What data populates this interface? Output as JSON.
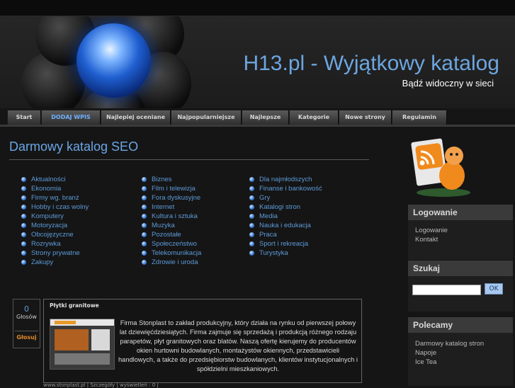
{
  "header": {
    "title": "H13.pl - Wyjątkowy katalog",
    "subtitle": "Bądź widoczny w sieci"
  },
  "nav": [
    {
      "label": "Start"
    },
    {
      "label": "DODAJ WPIS"
    },
    {
      "label": "Najlepiej oceniane"
    },
    {
      "label": "Najpopularniejsze"
    },
    {
      "label": "Najlepsze"
    },
    {
      "label": "Kategorie"
    },
    {
      "label": "Nowe strony"
    },
    {
      "label": "Regulamin"
    }
  ],
  "main": {
    "title": "Darmowy katalog SEO",
    "categories": {
      "col1": [
        "Aktualności",
        "Ekonomia",
        "Firmy wg. branż",
        "Hobby i czas wolny",
        "Komputery",
        "Motoryzacja",
        "Obcojęzyczne",
        "Rozrywka",
        "Strony prywatne",
        "Zakupy"
      ],
      "col2": [
        "Biznes",
        "Film i telewizja",
        "Fora dyskusyjne",
        "Internet",
        "Kultura i sztuka",
        "Muzyka",
        "Pozostałe",
        "Społeczeństwo",
        "Telekomunikacja",
        "Zdrowie i uroda"
      ],
      "col3": [
        "Dla najmłodszych",
        "Finanse i bankowość",
        "Gry",
        "Katalogi stron",
        "Media",
        "Nauka i edukacja",
        "Praca",
        "Sport i rekreacja",
        "Turystyka"
      ]
    }
  },
  "entry": {
    "votes": "0",
    "votes_label": "Głosów",
    "vote_button": "Głosuj",
    "title": "Płytki granitowe",
    "text": "Firma Stonplast to zakład produkcyjny, który działa na rynku od pierwszej połowy lat dziewięćdziesiątych. Firma zajmuje się sprzedażą i produkcją różnego rodzaju parapetów, płyt granitowych oraz blatów. Naszą ofertę kierujemy do producentów okien hurtowni budowlanych, montażystów okiennych, przedstawicieli handlowych, a także do przedsiębiorstw budowlanych, klientów instytucjonalnych i spółdzielni mieszkaniowych.",
    "footer": "www.stonplast.pl | Szczegóły | wyświetleń : 0 |"
  },
  "sidebar": {
    "login": {
      "heading": "Logowanie",
      "links": [
        "Logowanie",
        "Kontakt"
      ]
    },
    "search": {
      "heading": "Szukaj",
      "button": "OK",
      "value": ""
    },
    "recommended": {
      "heading": "Polecamy",
      "links": [
        "Darmowy katalog stron",
        "Napoje",
        "Ice Tea"
      ]
    }
  },
  "colors": {
    "accent_blue": "#6da6e0",
    "link_blue": "#5d9ad8",
    "vote_orange": "#e08a2a",
    "background": "#151515"
  }
}
